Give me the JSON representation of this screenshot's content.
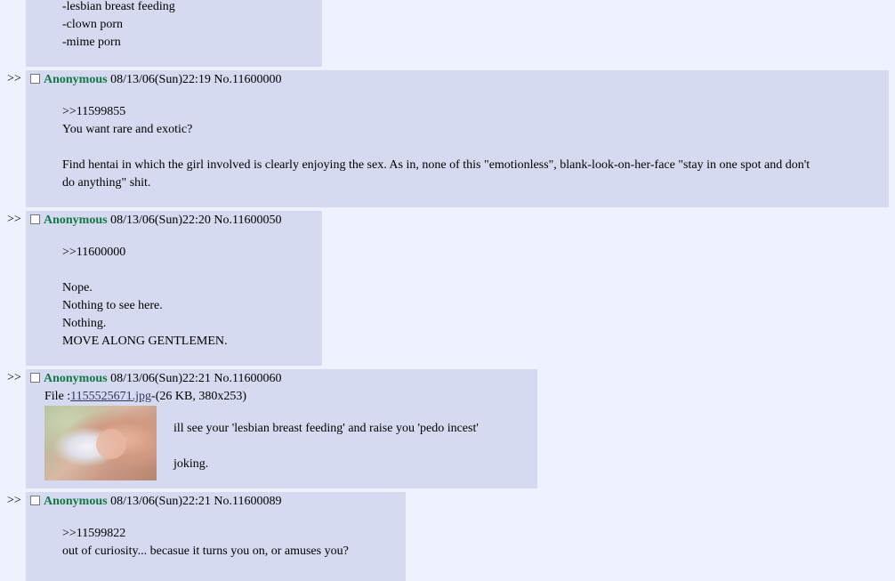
{
  "posts": [
    {
      "lines": [
        "-lesbian breast feeding",
        "-clown porn",
        "-mime porn"
      ]
    },
    {
      "arrow": ">>",
      "name": "Anonymous",
      "datetime": "08/13/06(Sun)22:19",
      "number": "No.11600000",
      "lines": [
        ">>11599855",
        "You want rare and exotic?",
        "",
        "Find hentai in which the girl involved is clearly enjoying the sex. As in, none of this \"emotionless\", blank-look-on-her-face \"stay in one spot and don't",
        "do anything\" shit."
      ]
    },
    {
      "arrow": ">>",
      "name": "Anonymous",
      "datetime": "08/13/06(Sun)22:20",
      "number": "No.11600050",
      "lines": [
        ">>11600000",
        "",
        "Nope.",
        "Nothing to see here.",
        "Nothing.",
        "MOVE ALONG GENTLEMEN."
      ]
    },
    {
      "arrow": ">>",
      "name": "Anonymous",
      "datetime": "08/13/06(Sun)22:21",
      "number": "No.11600060",
      "file_prefix": "File :",
      "file_name": "1155525671.jpg",
      "file_info": "-(26 KB, 380x253)",
      "lines": [
        "ill see your 'lesbian breast feeding' and raise you 'pedo incest'",
        "",
        "joking."
      ]
    },
    {
      "arrow": ">>",
      "name": "Anonymous",
      "datetime": "08/13/06(Sun)22:21",
      "number": "No.11600089",
      "lines": [
        ">>11599822",
        "out of curiosity... becasue it turns you on, or amuses you?"
      ]
    }
  ]
}
